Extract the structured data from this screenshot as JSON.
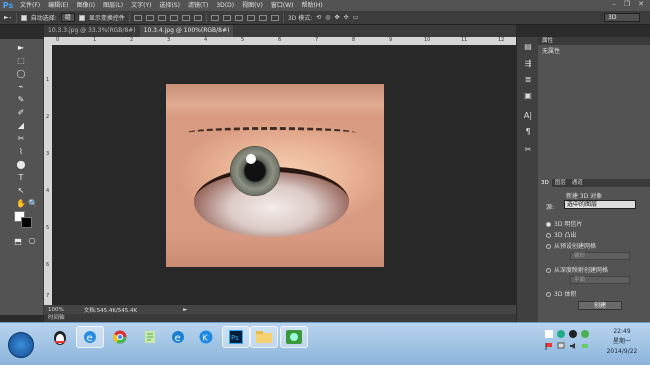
{
  "app": {
    "logo": "Ps"
  },
  "menu": [
    "文件(F)",
    "编辑(E)",
    "图像(I)",
    "图层(L)",
    "文字(Y)",
    "选择(S)",
    "滤镜(T)",
    "3D(D)",
    "视图(V)",
    "窗口(W)",
    "帮助(H)"
  ],
  "window_controls": {
    "minimize": "–",
    "restore": "❐",
    "close": "✕"
  },
  "options": {
    "move_tool": "►₊",
    "auto_select_label": "自动选择:",
    "auto_select_value": "组",
    "show_transform_label": "显示变换控件",
    "mode_3d_label": "3D 模式:",
    "workspace": "3D"
  },
  "tabs": [
    {
      "label": "10.3.3.jpg @ 33.3%(RGB/8#)",
      "active": false
    },
    {
      "label": "10.3.4.jpg @ 100%(RGB/8#)",
      "active": true
    }
  ],
  "ruler_top": [
    "0",
    "1",
    "2",
    "3",
    "4",
    "5",
    "6",
    "7",
    "8",
    "9",
    "10",
    "11",
    "12"
  ],
  "ruler_left": [
    "1",
    "2",
    "3",
    "4",
    "5",
    "6",
    "7"
  ],
  "docbar": {
    "zoom": "100%",
    "doc_info": "文档:545.4K/545.4K",
    "arrow": "►"
  },
  "timeline_label": "时间轴",
  "tools": [
    "►",
    "⬚",
    "◯",
    "⌁",
    "✎",
    "✐",
    "◢",
    "✂",
    "⌇",
    "⬤",
    "T",
    "↖",
    "✋",
    "🔍",
    "⬒",
    "⎔"
  ],
  "properties": {
    "header": "属性",
    "no_properties": "无属性"
  },
  "panel3d": {
    "tabs": [
      "3D",
      "图层",
      "通道"
    ],
    "new_object": "新建 3D 对象",
    "source_label": "源:",
    "source_value": "选中的图层",
    "options": [
      "3D 明信片",
      "3D 凸出",
      "从预设创建网格",
      "从深度映射创建网格",
      "3D 体积"
    ],
    "preset_value": "锥形",
    "depth_value": "平面",
    "create_button": "创建"
  },
  "taskbar": {
    "clock_time": "22:49",
    "clock_day": "星期一",
    "clock_date": "2014/9/22"
  },
  "colors": {
    "menubar": "#535353",
    "canvas": "#282828",
    "panel": "#535353",
    "taskbar": "#8cb4dc"
  }
}
